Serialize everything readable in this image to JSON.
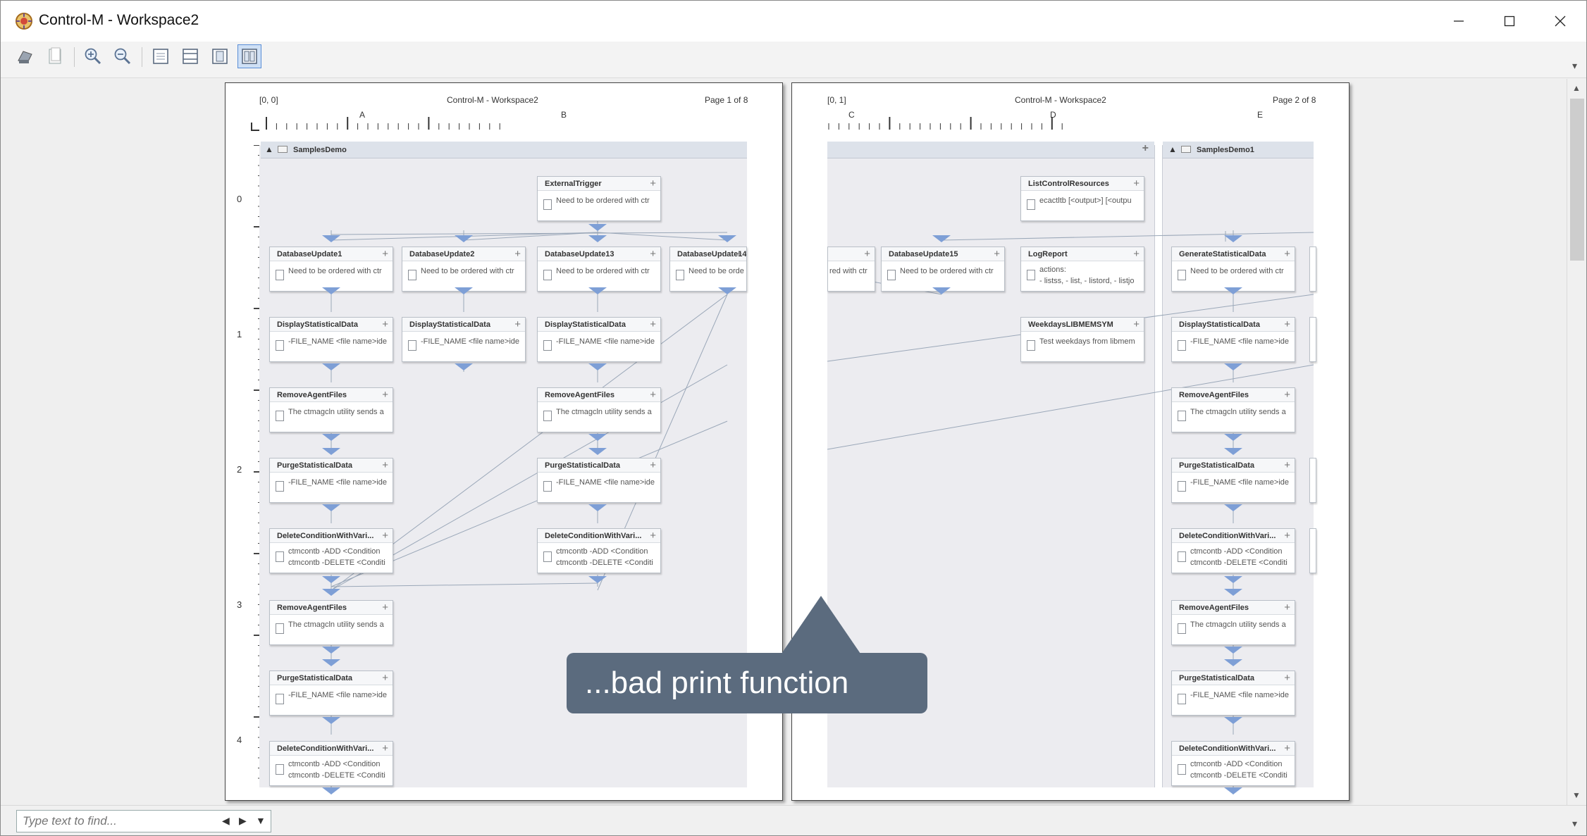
{
  "window": {
    "title": "Control-M - Workspace2",
    "minimize": "—",
    "maximize": "☐",
    "close": "✕"
  },
  "toolbar": {
    "items": [
      "print",
      "page",
      "zoom-in",
      "zoom-out",
      "fit-page",
      "fit-width",
      "single-page",
      "two-pages"
    ],
    "active": "two-pages"
  },
  "pages": [
    {
      "coord": "[0, 0]",
      "title": "Control-M - Workspace2",
      "page": "Page 1 of 8",
      "columns": [
        "A",
        "B"
      ],
      "group": "SamplesDemo"
    },
    {
      "coord": "[0, 1]",
      "title": "Control-M - Workspace2",
      "page": "Page 2 of 8",
      "columns": [
        "C",
        "D",
        "E"
      ],
      "group": "SamplesDemo1"
    }
  ],
  "rows": [
    "0",
    "1",
    "2",
    "3",
    "4"
  ],
  "jobs": {
    "trigger": {
      "name": "ExternalTrigger",
      "desc": "Need to be ordered with ctr"
    },
    "db1": {
      "name": "DatabaseUpdate1",
      "desc": "Need to be ordered with ctr"
    },
    "db2": {
      "name": "DatabaseUpdate2",
      "desc": "Need to be ordered with ctr"
    },
    "db13": {
      "name": "DatabaseUpdate13",
      "desc": "Need to be ordered with ctr"
    },
    "db14": {
      "name": "DatabaseUpdate14",
      "desc": "Need to be orde"
    },
    "disp": {
      "name": "DisplayStatisticalData",
      "desc": "-FILE_NAME <file name>ide"
    },
    "remove": {
      "name": "RemoveAgentFiles",
      "desc": "The ctmagcln utility sends a"
    },
    "purge": {
      "name": "PurgeStatisticalData",
      "desc": "-FILE_NAME <file name>ide"
    },
    "delcond": {
      "name": "DeleteConditionWithVari...",
      "desc1": "ctmcontb -ADD <Condition",
      "desc2": "ctmcontb -DELETE <Conditi"
    },
    "partial": {
      "desc": "red with ctr"
    },
    "db15": {
      "name": "DatabaseUpdate15",
      "desc": "Need to be ordered with ctr"
    },
    "listctl": {
      "name": "ListControlResources",
      "desc": "ecactltb [<output>] [<outpu"
    },
    "logreport": {
      "name": "LogReport",
      "desc1": "actions:",
      "desc2": "- listss, - list, - listord, - listjo"
    },
    "weekdays": {
      "name": "WeekdaysLIBMEMSYM",
      "desc": "Test weekdays from libmem"
    },
    "genstat": {
      "name": "GenerateStatisticalData",
      "desc": "Need to be ordered with ctr"
    }
  },
  "callout": {
    "text": "...bad print function"
  },
  "find": {
    "placeholder": "Type text to find..."
  }
}
